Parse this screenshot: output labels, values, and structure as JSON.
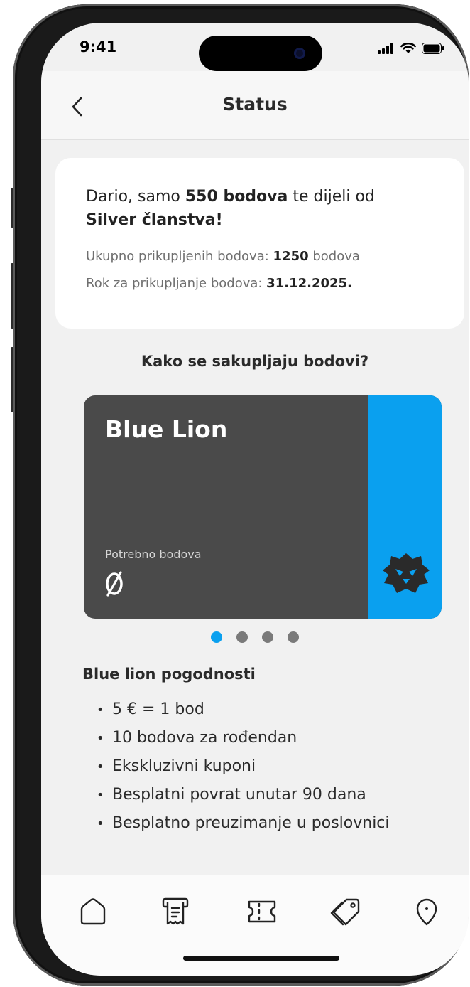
{
  "status_bar": {
    "time": "9:41"
  },
  "navbar": {
    "title": "Status"
  },
  "info": {
    "headline_pre": "Dario, samo ",
    "headline_points": "550 bodova",
    "headline_mid": " te dijeli od ",
    "headline_tier": "Silver članstva!",
    "total_label": "Ukupno prikupljenih bodova: ",
    "total_value": "1250",
    "total_unit": " bodova",
    "deadline_label": "Rok za prikupljanje bodova: ",
    "deadline_value": "31.12.2025."
  },
  "section_question": "Kako se sakupljaju bodovi?",
  "tier_card": {
    "name": "Blue Lion",
    "required_label": "Potrebno bodova",
    "required_value": "0",
    "card_color": "#4a4a4a",
    "accent_color": "#0aa0ef",
    "icon": "lion-icon"
  },
  "carousel": {
    "count": 4,
    "active_index": 0
  },
  "benefits": {
    "title": "Blue lion pogodnosti",
    "items": [
      "5 € = 1 bod",
      "10 bodova za rođendan",
      "Ekskluzivni kuponi",
      "Besplatni povrat unutar 90 dana",
      "Besplatno preuzimanje u poslovnici"
    ]
  },
  "tabbar": {
    "icons": [
      "home-icon",
      "receipt-icon",
      "ticket-icon",
      "tags-icon",
      "location-pin-icon"
    ]
  }
}
